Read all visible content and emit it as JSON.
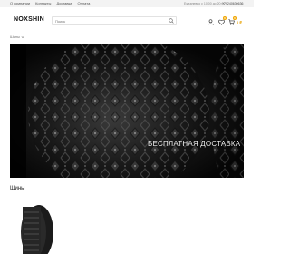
{
  "topbar": {
    "nav": [
      "О компании",
      "Контакты",
      "Доставка",
      "Оплата"
    ],
    "hours": "Ежедневно с 10:00 до 20:00",
    "phone": "+79240630636"
  },
  "header": {
    "logo": "NOXSHIN",
    "search_placeholder": "Поиск",
    "favorites_count": "0",
    "cart_count": "0",
    "cart_total": "0 ₽"
  },
  "breadcrumb": {
    "home": "Шины"
  },
  "banner": {
    "text": "БЕСПЛАТНАЯ ДОСТАВКА"
  },
  "section": {
    "title": "Шины"
  },
  "colors": {
    "accent": "#f0a500",
    "banner_bg": "#0b0b0b"
  }
}
